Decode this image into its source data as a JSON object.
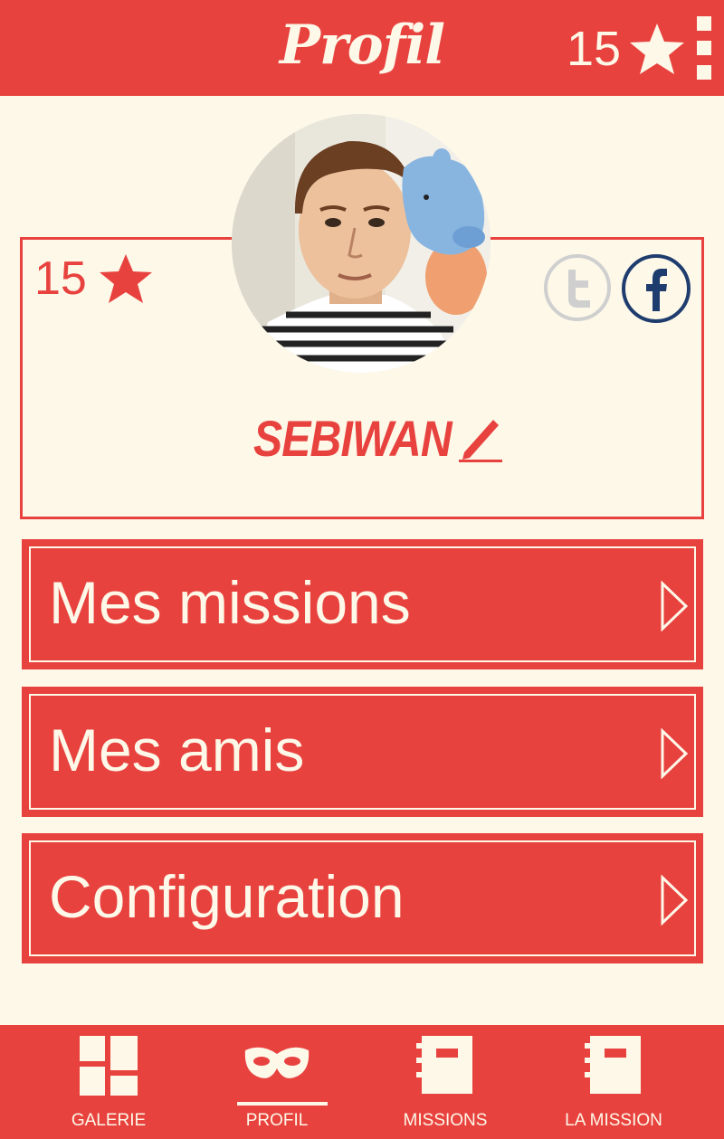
{
  "header": {
    "title": "Profil",
    "star_count": "15"
  },
  "profile": {
    "star_count": "15",
    "username": "SEBIWAN"
  },
  "menu": [
    {
      "label": "Mes missions"
    },
    {
      "label": "Mes amis"
    },
    {
      "label": "Configuration"
    }
  ],
  "bottom_nav": {
    "items": [
      {
        "label": "GALERIE",
        "icon": "gallery-icon"
      },
      {
        "label": "PROFIL",
        "icon": "mask-icon",
        "active": true
      },
      {
        "label": "MISSIONS",
        "icon": "notebook-icon"
      },
      {
        "label": "LA MISSION",
        "icon": "notebook-icon"
      }
    ]
  },
  "colors": {
    "primary": "#e8423f",
    "background": "#fdf8e8",
    "facebook": "#1e3c6e",
    "twitter_disabled": "#cfcfcf"
  }
}
